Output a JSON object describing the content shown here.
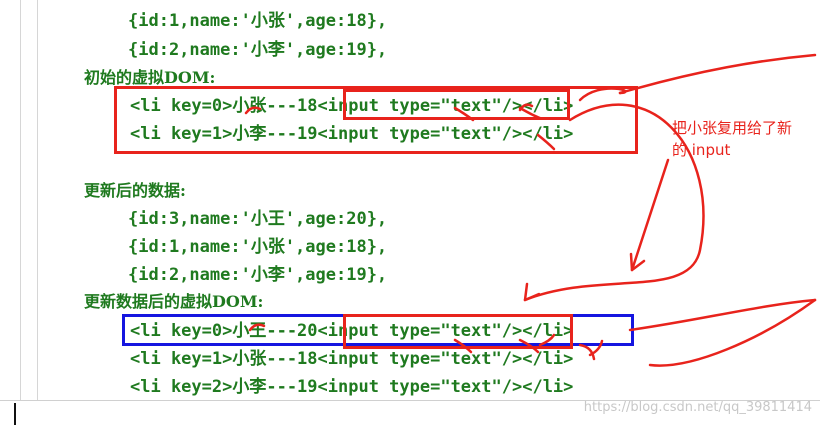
{
  "lines": {
    "l1": "{id:1,name:'小张',age:18},",
    "l2": "{id:2,name:'小李',age:19},",
    "initial_heading": "初始的虚拟DOM:",
    "init_li0": "<li key=0>小张---18<input type=\"text\"/></li>",
    "init_li1": "<li key=1>小李---19<input type=\"text\"/></li>",
    "updated_heading": "更新后的数据:",
    "u1": "{id:3,name:'小王',age:20},",
    "u2": "{id:1,name:'小张',age:18},",
    "u3": "{id:2,name:'小李',age:19},",
    "new_heading": "更新数据后的虚拟DOM:",
    "new_li0": "<li key=0>小王---20<input type=\"text\"/></li>",
    "new_li1": "<li key=1>小张---18<input type=\"text\"/></li>",
    "new_li2": "<li key=2>小李---19<input type=\"text\"/></li>"
  },
  "annotation": {
    "note_line1": "把小张复用给了新",
    "note_line2": "的 input"
  },
  "watermark": "https://blog.csdn.net/qq_39811414",
  "colors": {
    "code_text": "#1f7a1f",
    "annotation_red": "#e8231c",
    "annotation_blue": "#1515e0"
  }
}
